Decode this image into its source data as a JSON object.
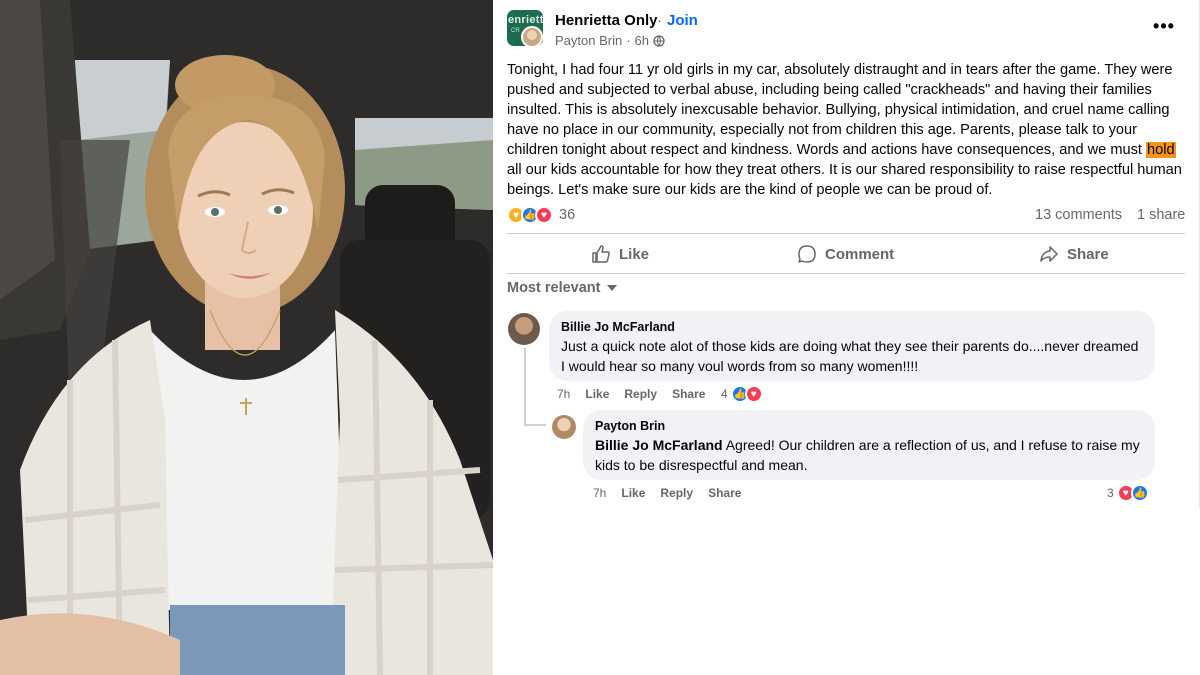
{
  "post": {
    "group_name": "Henrietta Only",
    "separator": "·",
    "join_label": "Join",
    "author": "Payton Brin",
    "time": "6h",
    "more_icon": "more-icon",
    "text_before": "Tonight, I had four 11 yr old girls in my car, absolutely distraught and in tears after the game. They were pushed and subjected to verbal abuse, including being called \"crackheads\" and having their families insulted. This is absolutely inexcusable behavior. Bullying, physical intimidation, and cruel name calling have no place in our community, especially not from children this age. Parents, please talk to your children tonight about respect and kindness. Words and actions have consequences, and we must ",
    "text_highlight": "hold",
    "text_after": " all our kids accountable for how they treat others. It is our shared responsibility to raise respectful human beings. Let's make sure our kids are the kind of people we can be proud of.",
    "reaction_count": "36",
    "comments_count": "13 comments",
    "shares_count": "1 share"
  },
  "actions": {
    "like": "Like",
    "comment": "Comment",
    "share": "Share"
  },
  "sort_label": "Most relevant",
  "group_avatar_text": "enriett",
  "group_avatar_sub": "CR",
  "comments": [
    {
      "author": "Billie Jo McFarland",
      "text": "Just a quick note alot of those kids are doing what they see their parents do....never dreamed I would hear so many voul words from so many women!!!!",
      "time": "7h",
      "like": "Like",
      "reply": "Reply",
      "share": "Share",
      "reactions": "4"
    },
    {
      "author": "Payton Brin",
      "mention": "Billie Jo McFarland",
      "text": " Agreed! Our children are a reflection of us, and I refuse to raise my kids to be disrespectful and mean.",
      "time": "7h",
      "like": "Like",
      "reply": "Reply",
      "share": "Share",
      "reactions": "3"
    }
  ],
  "colors": {
    "link_blue": "#0866ff",
    "secondary_text": "#65676b",
    "bubble_bg": "#f0f2f5",
    "highlight": "#f7931e"
  }
}
